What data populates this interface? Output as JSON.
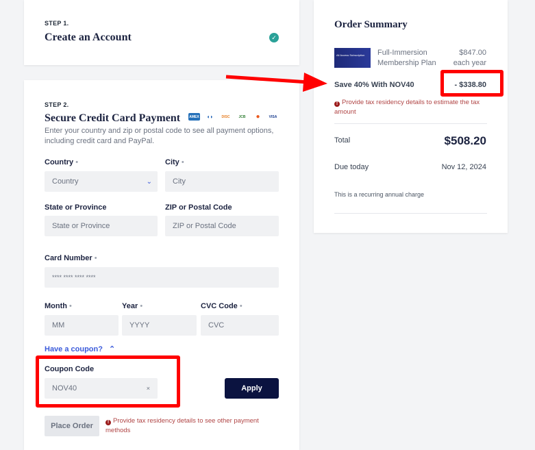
{
  "step1": {
    "step": "STEP 1.",
    "title": "Create an Account"
  },
  "step2": {
    "step": "STEP 2.",
    "title": "Secure Credit Card Payment",
    "description": "Enter your country and zip or postal code to see all payment options, including credit card and PayPal.",
    "card_brands": [
      "amex",
      "diners",
      "discover",
      "jcb",
      "mastercard",
      "visa"
    ],
    "country": {
      "label": "Country",
      "placeholder": "Country"
    },
    "city": {
      "label": "City",
      "placeholder": "City"
    },
    "state": {
      "label": "State or Province",
      "placeholder": "State or Province"
    },
    "zip": {
      "label": "ZIP or Postal Code",
      "placeholder": "ZIP or Postal Code"
    },
    "card_number": {
      "label": "Card Number",
      "placeholder": "**** **** **** ****"
    },
    "month": {
      "label": "Month",
      "placeholder": "MM"
    },
    "year": {
      "label": "Year",
      "placeholder": "YYYY"
    },
    "cvc": {
      "label": "CVC Code",
      "placeholder": "CVC"
    },
    "required_mark": "•",
    "coupon_toggle": "Have a coupon?",
    "coupon": {
      "label": "Coupon Code",
      "value": "NOV40",
      "clear": "×"
    },
    "apply": "Apply",
    "place_order": "Place Order",
    "error": "Provide tax residency details to see other payment methods"
  },
  "summary": {
    "title": "Order Summary",
    "thumb_text": "All Access Subscription",
    "product": "Full-Immersion Membership Plan",
    "price": "$847.00",
    "period": "each year",
    "discount_label": "Save 40% With NOV40",
    "discount": "- $338.80",
    "tax_error": "Provide tax residency details to estimate the tax amount",
    "total_label": "Total",
    "total": "$508.20",
    "due_label": "Due today",
    "due_date": "Nov 12, 2024",
    "note": "This is a recurring annual charge"
  },
  "colors": {
    "accent": "#0b1340",
    "annotation": "#ff0000",
    "check": "#2aa198",
    "link": "#3b5bdb",
    "error": "#b04545"
  }
}
